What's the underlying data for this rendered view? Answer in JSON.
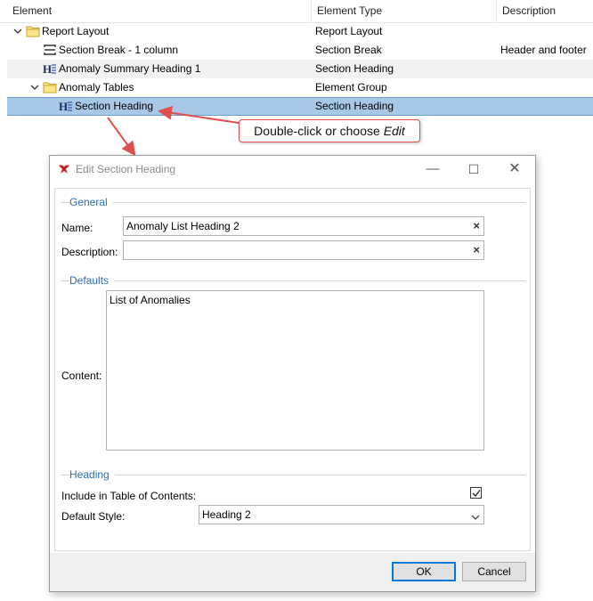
{
  "grid": {
    "columns": [
      "Element",
      "Element Type",
      "Description"
    ],
    "rows": [
      {
        "label": "Report Layout",
        "type": "Report Layout",
        "description": ""
      },
      {
        "label": "Section Break - 1 column",
        "type": "Section Break",
        "description": "Header and footer"
      },
      {
        "label": "Anomaly Summary Heading 1",
        "type": "Section Heading",
        "description": ""
      },
      {
        "label": "Anomaly Tables",
        "type": "Element Group",
        "description": ""
      },
      {
        "label": "Section Heading",
        "type": "Section Heading",
        "description": ""
      }
    ],
    "icons": {
      "folder": "folder-icon",
      "section_break": "section-break-icon",
      "heading": "heading-icon",
      "expanded": "chevron-down-icon"
    }
  },
  "callout": {
    "prefix": "Double-click or choose ",
    "emphasis": "Edit"
  },
  "dialog": {
    "title": "Edit Section Heading",
    "window_buttons": {
      "minimize": "—",
      "maximize": "☐",
      "close": "✕"
    },
    "sections": {
      "general": "General",
      "defaults": "Defaults",
      "heading": "Heading"
    },
    "fields": {
      "name_label": "Name:",
      "name_value": "Anomaly List Heading 2",
      "description_label": "Description:",
      "description_value": "",
      "content_label": "Content:",
      "content_value": "List of Anomalies",
      "include_toc_label": "Include in Table of Contents:",
      "include_toc_checked": true,
      "default_style_label": "Default Style:",
      "default_style_value": "Heading 2",
      "clear_glyph": "×"
    },
    "buttons": {
      "ok": "OK",
      "cancel": "Cancel"
    }
  },
  "colors": {
    "selection": "#a8c8e8",
    "section_label": "#2f6fb5",
    "callout_border": "#e05050",
    "arrow": "#e05050"
  }
}
